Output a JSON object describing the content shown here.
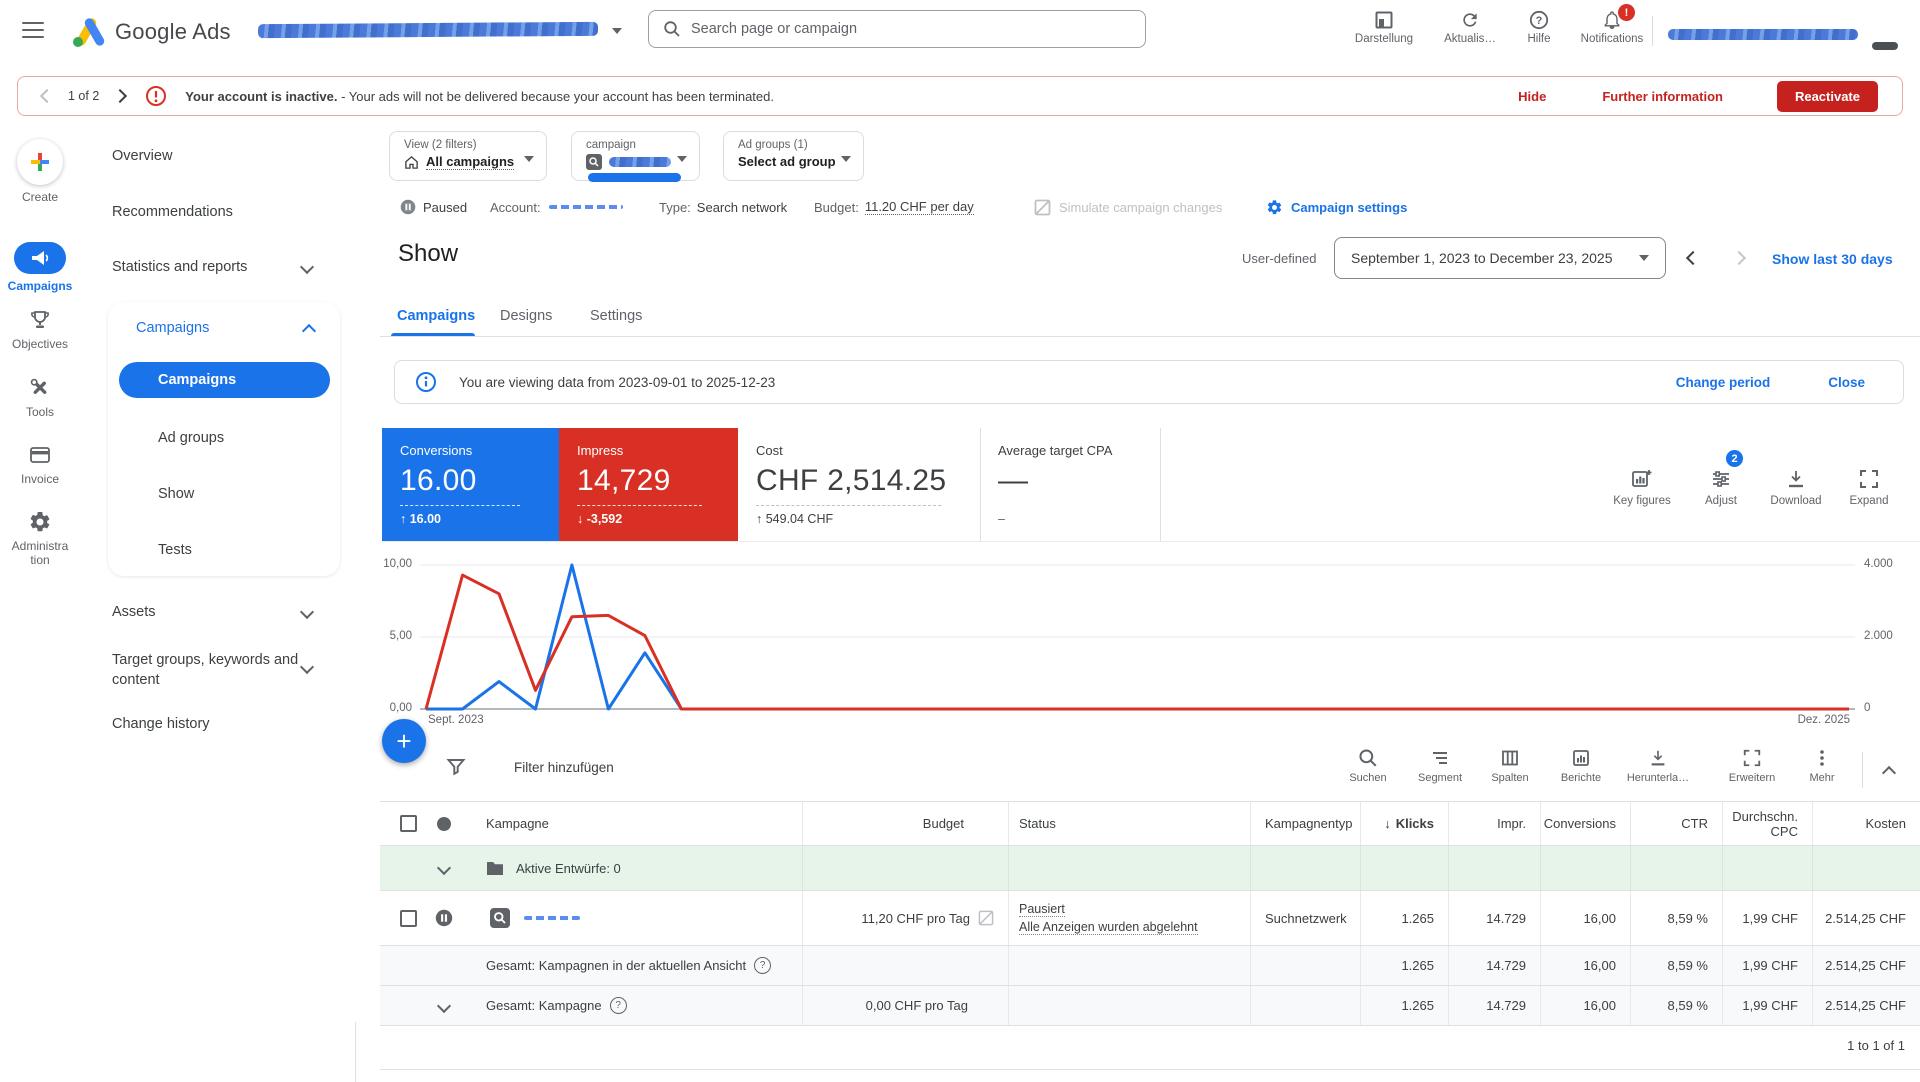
{
  "topbar": {
    "brand": "Google Ads",
    "search_placeholder": "Search page or campaign",
    "actions": {
      "appearance": "Darstellung",
      "refresh": "Aktualis…",
      "help": "Hilfe",
      "notifications": "Notifications",
      "notification_badge": "!"
    }
  },
  "alert_banner": {
    "pager": "1 of 2",
    "message_bold": "Your account is inactive.",
    "message_rest": " - Your ads will not be delivered because your account has been terminated.",
    "hide": "Hide",
    "more_info": "Further information",
    "reactivate": "Reactivate"
  },
  "rail": {
    "create": "Create",
    "campaigns": "Campaigns",
    "objectives": "Objectives",
    "tools": "Tools",
    "invoice": "Invoice",
    "administration": "Administra tion"
  },
  "nav": {
    "overview": "Overview",
    "recommendations": "Recommendations",
    "statistics": "Statistics and reports",
    "campaigns_group": "Campaigns",
    "campaigns": "Campaigns",
    "ad_groups": "Ad groups",
    "show": "Show",
    "tests": "Tests",
    "assets": "Assets",
    "targeting": "Target groups, keywords and content",
    "change_history": "Change history"
  },
  "filters": {
    "view_label": "View (2 filters)",
    "view_value": "All campaigns",
    "campaign_label": "campaign",
    "adgroup_label": "Ad groups (1)",
    "adgroup_value": "Select ad group"
  },
  "statusbar": {
    "state": "Paused",
    "account_label": "Account:",
    "type_label": "Type:",
    "type_value": "Search network",
    "budget_label": "Budget:",
    "budget_value": "11.20 CHF per day",
    "simulate": "Simulate campaign changes",
    "settings": "Campaign settings"
  },
  "page": {
    "title": "Show",
    "date_mode": "User-defined",
    "date_range": "September 1, 2023 to December 23, 2025",
    "quick_range": "Show last 30 days"
  },
  "tabs": {
    "campaigns": "Campaigns",
    "designs": "Designs",
    "settings": "Settings"
  },
  "info_banner": {
    "text": "You are viewing data from 2023-09-01 to 2025-12-23",
    "change": "Change period",
    "close": "Close"
  },
  "scorecards": [
    {
      "label": "Conversions",
      "value": "16.00",
      "delta": "↑ 16.00",
      "bg": "#1a73e8"
    },
    {
      "label": "Impress",
      "value": "14,729",
      "delta": "↓ -3,592",
      "bg": "#d93025"
    },
    {
      "label": "Cost",
      "value": "CHF 2,514.25",
      "delta": "↑ 549.04 CHF",
      "bg": "#ffffff"
    },
    {
      "label": "Average target CPA",
      "value": "—",
      "delta": "–",
      "bg": "#ffffff"
    }
  ],
  "chart_tools": {
    "key_figures": "Key figures",
    "adjust": "Adjust",
    "adjust_badge": "2",
    "download": "Download",
    "expand": "Expand"
  },
  "chart_data": {
    "type": "line",
    "x_start_label": "Sept. 2023",
    "x_end_label": "Dez. 2025",
    "left_axis": {
      "ticks": [
        "0,00",
        "5,00",
        "10,00"
      ],
      "max": 10
    },
    "right_axis": {
      "ticks": [
        "0",
        "2.000",
        "4.000"
      ],
      "max": 4000
    },
    "grid": true,
    "series": [
      {
        "name": "Conversions",
        "axis": "left",
        "color": "#1a73e8",
        "values": [
          0,
          0,
          1.9,
          0,
          10,
          0,
          3.9,
          0,
          0,
          0,
          0,
          0,
          0,
          0,
          0,
          0,
          0,
          0,
          0,
          0,
          0,
          0,
          0,
          0,
          0,
          0,
          0,
          0,
          0,
          0,
          0,
          0,
          0,
          0,
          0,
          0,
          0,
          0,
          0,
          0
        ]
      },
      {
        "name": "Impressions",
        "axis": "right",
        "color": "#d93025",
        "values": [
          0,
          3720,
          3200,
          520,
          2560,
          2600,
          2040,
          0,
          0,
          0,
          0,
          0,
          0,
          0,
          0,
          0,
          0,
          0,
          0,
          0,
          0,
          0,
          0,
          0,
          0,
          0,
          0,
          0,
          0,
          0,
          0,
          0,
          0,
          0,
          0,
          0,
          0,
          0,
          0,
          0
        ]
      }
    ]
  },
  "table_toolbar": {
    "filter": "Filter hinzufügen",
    "search": "Suchen",
    "segment": "Segment",
    "columns": "Spalten",
    "reports": "Berichte",
    "download": "Herunterla…",
    "expand": "Erweitern",
    "more": "Mehr"
  },
  "table": {
    "columns": {
      "campaign": "Kampagne",
      "budget": "Budget",
      "status": "Status",
      "type": "Kampagnentyp",
      "clicks": "Klicks",
      "impr": "Impr.",
      "conversions": "Conversions",
      "ctr": "CTR",
      "cpc": "Durchschn. CPC",
      "cost": "Kosten",
      "sort_arrow": "↓"
    },
    "draft_row": "Aktive Entwürfe: 0",
    "campaign_row": {
      "budget": "11,20 CHF pro Tag",
      "status_line1": "Pausiert",
      "status_line2": "Alle Anzeigen wurden abgelehnt",
      "type": "Suchnetzwerk",
      "clicks": "1.265",
      "impr": "14.729",
      "conversions": "16,00",
      "ctr": "8,59 %",
      "cpc": "1,99 CHF",
      "cost": "2.514,25 CHF"
    },
    "total_view": {
      "label": "Gesamt: Kampagnen in der aktuellen Ansicht",
      "clicks": "1.265",
      "impr": "14.729",
      "conversions": "16,00",
      "ctr": "8,59 %",
      "cpc": "1,99 CHF",
      "cost": "2.514,25 CHF"
    },
    "total_campaign": {
      "label": "Gesamt: Kampagne",
      "budget": "0,00 CHF pro Tag",
      "clicks": "1.265",
      "impr": "14.729",
      "conversions": "16,00",
      "ctr": "8,59 %",
      "cpc": "1,99 CHF",
      "cost": "2.514,25 CHF"
    },
    "pagination": "1 to 1 of 1"
  }
}
